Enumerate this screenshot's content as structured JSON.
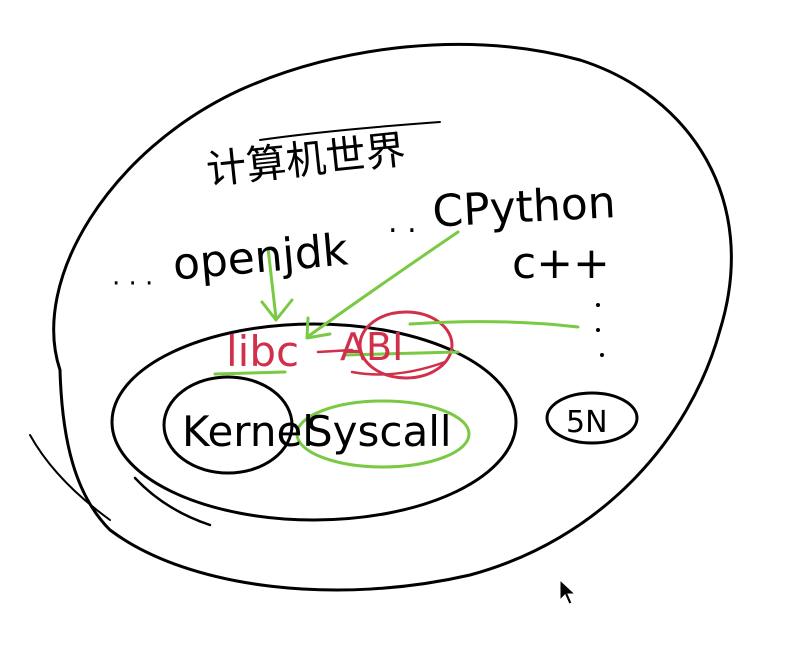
{
  "labels": {
    "top_chinese": "计算机世界",
    "openjdk": "openjdk",
    "cpython": "CPython",
    "cpp": "c++",
    "libc": "libc",
    "abi": "ABI",
    "kernel": "Kernel",
    "syscall": "Syscall",
    "small_circle": "5N",
    "dots_left": "· · ·",
    "dots_right": "·  ·  ·"
  },
  "colors": {
    "ink": "#000000",
    "red": "#d0304a",
    "green": "#7ac943",
    "paper": "#ffffff"
  },
  "icons": {
    "cursor": "mouse-pointer-icon"
  }
}
